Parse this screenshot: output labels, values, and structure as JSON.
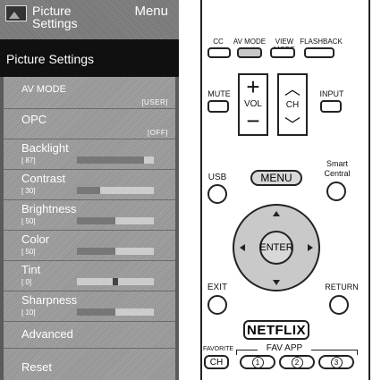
{
  "menu": {
    "header_title": "Picture Settings",
    "header_tag": "Menu",
    "section": "Picture Settings",
    "items": [
      {
        "label": "AV MODE",
        "value": "[USER]"
      },
      {
        "label": "OPC",
        "value": "[OFF]"
      },
      {
        "label": "Backlight",
        "value": "[ 87]",
        "level": 0.87
      },
      {
        "label": "Contrast",
        "value": "[ 30]",
        "level": 0.3
      },
      {
        "label": "Brightness",
        "value": "[ 50]",
        "level": 0.5
      },
      {
        "label": "Color",
        "value": "[ 50]",
        "level": 0.5
      },
      {
        "label": "Tint",
        "value": "[ 0]",
        "level": 0.5
      },
      {
        "label": "Sharpness",
        "value": "[ 10]",
        "level": 0.5
      },
      {
        "label": "Advanced"
      },
      {
        "label": "Reset"
      }
    ]
  },
  "remote": {
    "top_buttons": [
      "CC",
      "AV MODE",
      "VIEW MODE",
      "FLASHBACK"
    ],
    "mute": "MUTE",
    "vol": "VOL",
    "ch": "CH",
    "input": "INPUT",
    "usb": "USB",
    "menu": "MENU",
    "smart_central": "Smart Central",
    "enter": "ENTER",
    "exit": "EXIT",
    "return": "RETURN",
    "netflix": "NETFLIX",
    "favorite": "FAVORITE",
    "favorite_ch": "CH",
    "fav_app": "FAV APP",
    "fav_keys": [
      "1",
      "2",
      "3"
    ]
  }
}
